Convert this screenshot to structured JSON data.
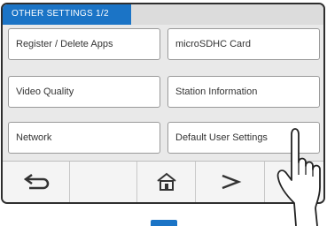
{
  "header": {
    "title": "OTHER SETTINGS  1/2"
  },
  "menu": {
    "items": [
      {
        "label": "Register / Delete Apps"
      },
      {
        "label": "microSDHC Card"
      },
      {
        "label": "Video Quality"
      },
      {
        "label": "Station Information"
      },
      {
        "label": "Network"
      },
      {
        "label": "Default User Settings"
      }
    ]
  },
  "footer": {
    "icons": [
      "back-icon",
      "home-icon",
      "next-icon"
    ]
  },
  "colors": {
    "accent": "#1b74c6",
    "bezel": "#2e2e2e"
  }
}
